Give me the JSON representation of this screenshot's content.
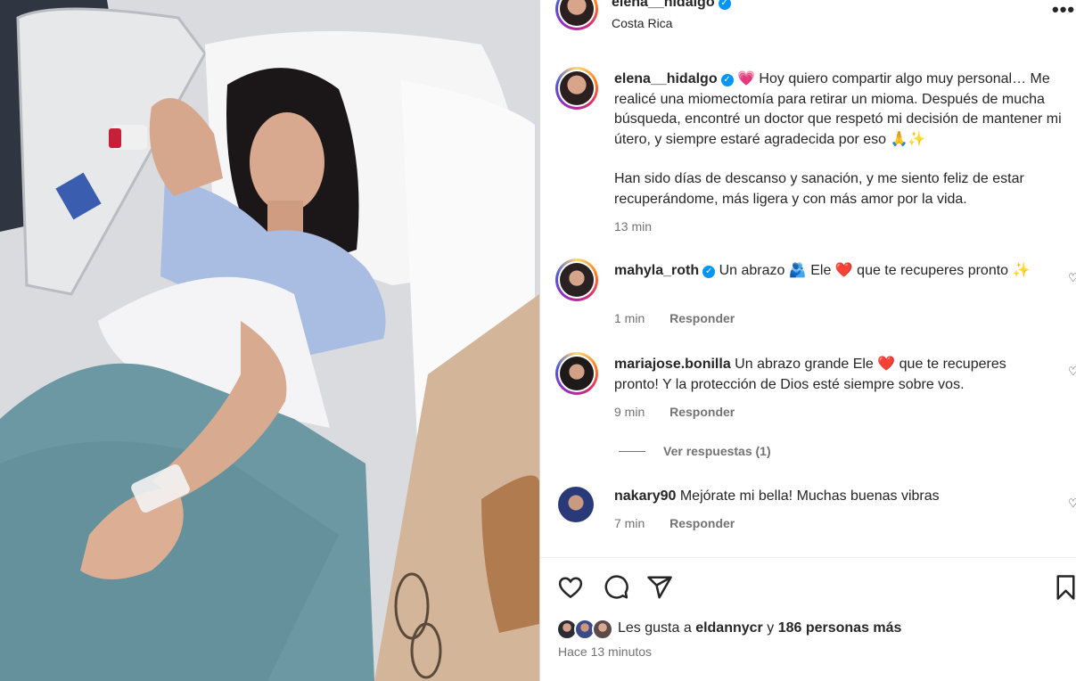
{
  "post": {
    "username": "elena__hidalgo",
    "location": "Costa Rica",
    "more_icon": "more-horizontal-icon"
  },
  "caption": {
    "username": "elena__hidalgo",
    "text1": "💗 Hoy quiero compartir algo muy personal… Me realicé una miomectomía para retirar un mioma. Después de mucha búsqueda, encontré un doctor que respetó mi decisión de mantener mi útero, y siempre estaré agradecida por eso 🙏✨",
    "text2": "Han sido días de descanso y sanación, y me siento feliz de estar recuperándome, más ligera y con más amor por la vida.",
    "time": "13 min"
  },
  "comments": [
    {
      "username": "mahyla_roth",
      "verified": true,
      "text": "Un abrazo 🫂 Ele ❤️ que te recuperes pronto ✨",
      "time": "1 min",
      "reply": "Responder"
    },
    {
      "username": "mariajose.bonilla",
      "verified": false,
      "text": "Un abrazo grande Ele ❤️ que te recuperes pronto! Y la protección de Dios esté siempre sobre vos.",
      "time": "9 min",
      "reply": "Responder"
    },
    {
      "username": "nakary90",
      "verified": false,
      "text": "Mejórate mi bella! Muchas buenas vibras",
      "time": "7 min",
      "reply": "Responder"
    }
  ],
  "view_replies": "Ver respuestas (1)",
  "likes": {
    "prefix": "Les gusta a",
    "user": "eldannycr",
    "joiner": "y",
    "others": "186 personas más"
  },
  "posted_ago": "Hace 13 minutos",
  "colors": {
    "verified": "#0095f6",
    "muted": "#737373",
    "text": "#262626"
  }
}
